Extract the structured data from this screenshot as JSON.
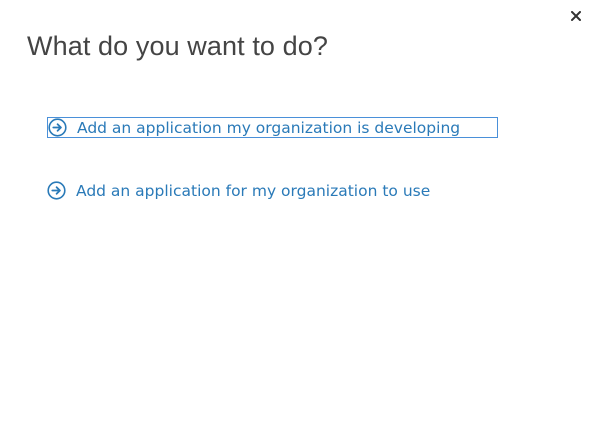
{
  "dialog": {
    "title": "What do you want to do?",
    "close_icon": "close-icon",
    "options": [
      {
        "label": "Add an application my organization is developing",
        "icon": "arrow-circle-icon",
        "focused": true
      },
      {
        "label": "Add an application for my organization to use",
        "icon": "arrow-circle-icon",
        "focused": false
      }
    ]
  },
  "colors": {
    "link": "#2a7ab8",
    "title": "#444444",
    "focus_outline": "#4a90d9",
    "close_icon": "#333333"
  }
}
